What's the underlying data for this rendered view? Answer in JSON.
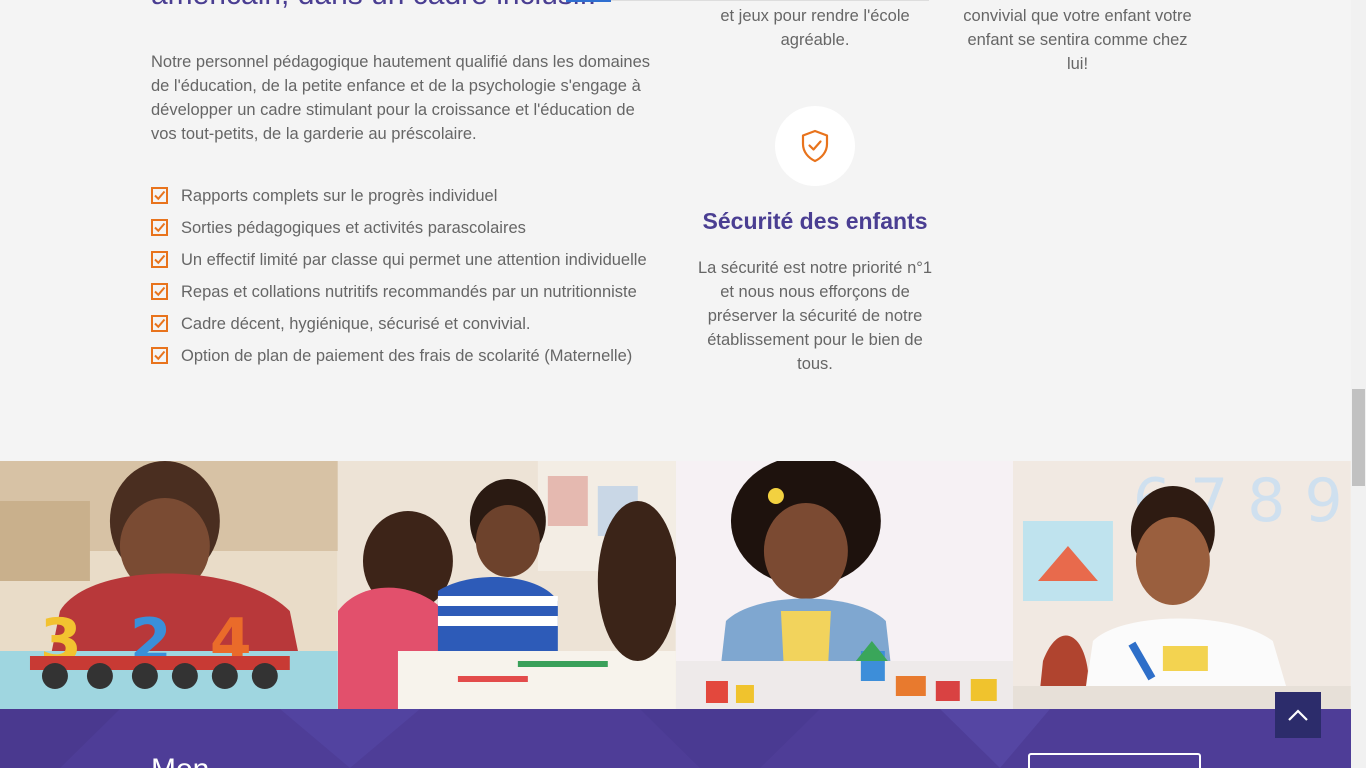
{
  "header": {
    "heading_fragment": "américain, dans un cadre inclusif."
  },
  "intro": {
    "text": "Notre personnel pédagogique hautement qualifié dans les domaines de l'éducation, de la petite enfance et de la psychologie s'engage à développer un cadre stimulant pour la croissance et l'éducation de vos tout-petits, de la garderie au préscolaire."
  },
  "checklist": {
    "icon": "checkbox-checked-icon",
    "items": [
      "Rapports complets sur le progrès individuel",
      "Sorties pédagogiques et activités parascolaires",
      "Un effectif limité par classe qui permet une attention individuelle",
      "Repas et collations nutritifs recommandés par un nutritionniste",
      "Cadre décent, hygiénique, sécurisé et convivial.",
      "Option de plan de paiement des frais de scolarité (Maternelle)"
    ]
  },
  "features": {
    "activities_text": "et jeux pour rendre l'école agréable.",
    "environment_text": "convivial que votre enfant votre enfant se sentira comme chez lui!",
    "safety": {
      "icon": "shield-check-icon",
      "title": "Sécurité des enfants",
      "text": "La sécurité est notre priorité n°1 et nous nous efforçons de préserver la sécurité de notre établissement pour le bien de tous."
    }
  },
  "gallery": {
    "photos": [
      "child-with-number-train-photo",
      "children-drawing-photo",
      "girl-with-blocks-photo",
      "boy-drawing-photo"
    ]
  },
  "band": {
    "title_fragment": "Mon ...",
    "button_label": ""
  },
  "back_to_top": {
    "icon": "chevron-up-icon"
  },
  "colors": {
    "accent_orange": "#e8731c",
    "brand_purple": "#4a3e92",
    "band_purple": "#4e3d97",
    "back_to_top_bg": "#2c2c6b"
  }
}
